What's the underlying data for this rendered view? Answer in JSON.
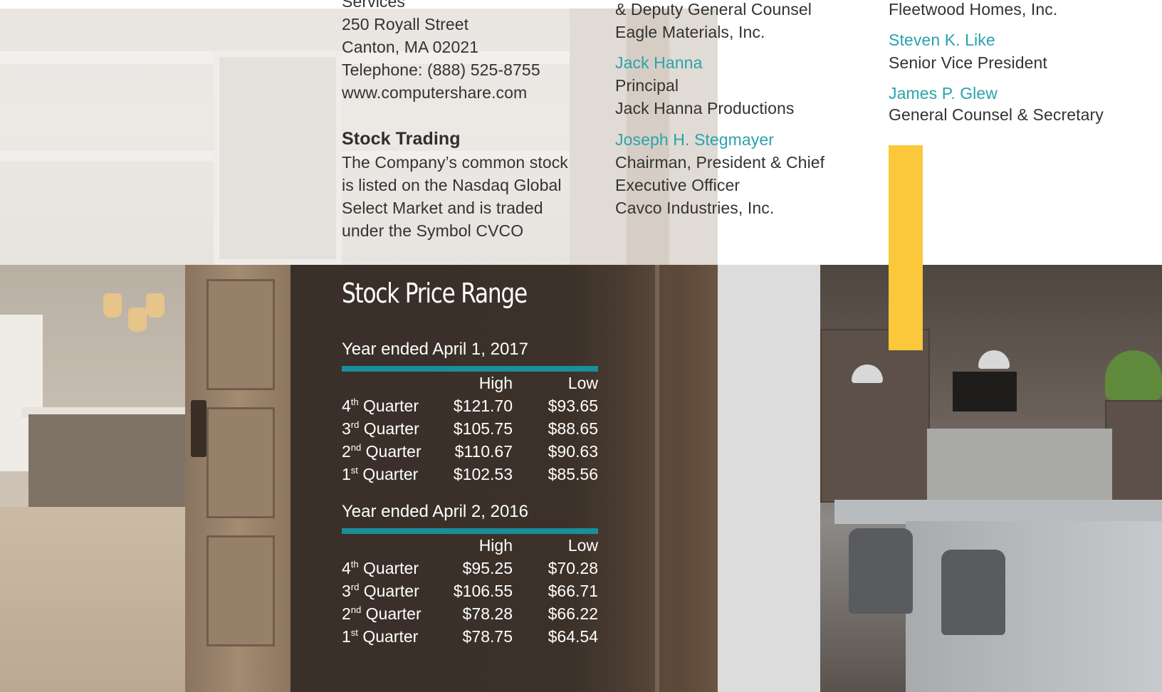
{
  "col1": {
    "address_partial": "Services",
    "address": [
      "250 Royall Street",
      "Canton, MA 02021",
      "Telephone: (888) 525-8755",
      "www.computershare.com"
    ],
    "stock_trading_heading": "Stock Trading",
    "stock_trading_text": [
      "The Company’s common stock",
      "is listed on the Nasdaq Global",
      "Select Market and is traded",
      "under the Symbol CVCO"
    ]
  },
  "col2": {
    "partial": [
      "& Deputy General Counsel",
      "Eagle Materials, Inc."
    ],
    "people": [
      {
        "name": "Jack Hanna",
        "lines": [
          "Principal",
          "Jack Hanna Productions"
        ]
      },
      {
        "name": "Joseph H. Stegmayer",
        "lines": [
          "Chairman, President & Chief",
          "Executive Officer",
          "Cavco Industries, Inc."
        ]
      }
    ]
  },
  "col3": {
    "partial": "Fleetwood Homes, Inc.",
    "people": [
      {
        "name": "Steven K. Like",
        "lines": [
          "Senior Vice President"
        ]
      },
      {
        "name": "James P. Glew",
        "lines": [
          "General Counsel & Secretary"
        ]
      }
    ]
  },
  "stock_price": {
    "title": "Stock Price Range",
    "high_label": "High",
    "low_label": "Low",
    "years": [
      {
        "heading": "Year ended April 1, 2017",
        "rows": [
          {
            "num": "4",
            "sup": "th",
            "label": "Quarter",
            "high": "$121.70",
            "low": "$93.65"
          },
          {
            "num": "3",
            "sup": "rd",
            "label": "Quarter",
            "high": "$105.75",
            "low": "$88.65"
          },
          {
            "num": "2",
            "sup": "nd",
            "label": "Quarter",
            "high": "$110.67",
            "low": "$90.63"
          },
          {
            "num": "1",
            "sup": "st",
            "label": "Quarter",
            "high": "$102.53",
            "low": "$85.56"
          }
        ]
      },
      {
        "heading": "Year ended April 2, 2016",
        "rows": [
          {
            "num": "4",
            "sup": "th",
            "label": "Quarter",
            "high": "$95.25",
            "low": "$70.28"
          },
          {
            "num": "3",
            "sup": "rd",
            "label": "Quarter",
            "high": "$106.55",
            "low": "$66.71"
          },
          {
            "num": "2",
            "sup": "nd",
            "label": "Quarter",
            "high": "$78.28",
            "low": "$66.22"
          },
          {
            "num": "1",
            "sup": "st",
            "label": "Quarter",
            "high": "$78.75",
            "low": "$64.54"
          }
        ]
      }
    ]
  },
  "colors": {
    "accent_teal": "#2aa3ad",
    "rule_teal": "#1a8e9b",
    "yellow": "#fbc73b"
  }
}
